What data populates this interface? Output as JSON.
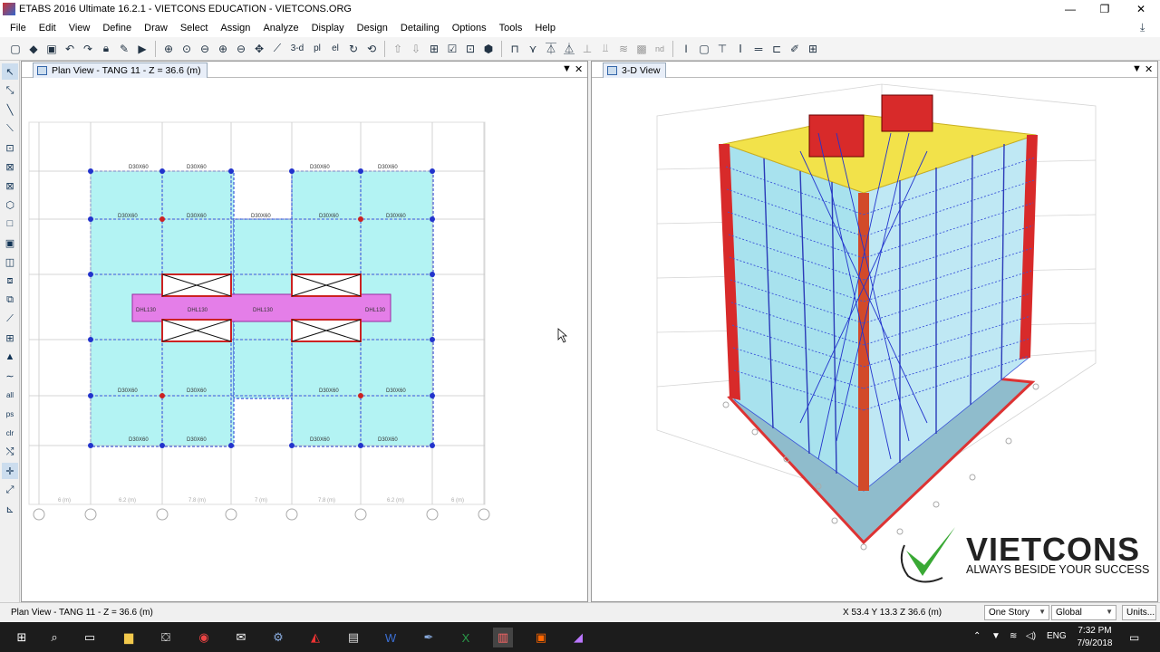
{
  "window": {
    "title": "ETABS 2016 Ultimate 16.2.1 - VIETCONS EDUCATION - VIETCONS.ORG",
    "minimize": "—",
    "maximize": "❐",
    "close": "✕"
  },
  "menu": [
    "File",
    "Edit",
    "View",
    "Define",
    "Draw",
    "Select",
    "Assign",
    "Analyze",
    "Display",
    "Design",
    "Detailing",
    "Options",
    "Tools",
    "Help"
  ],
  "toolbar": {
    "view_3d_label": "3-d",
    "plan_label": "pl",
    "elev_label": "el",
    "nd_label": "nd"
  },
  "left_pane": {
    "tab_title": "Plan View - TANG 11 - Z = 36.6 (m)",
    "dropdown_icon": "▼",
    "close_icon": "✕",
    "grid_labels": [
      "6 (m)",
      "6.2 (m)",
      "7.8 (m)",
      "7 (m)",
      "7.8 (m)",
      "6.2 (m)",
      "6 (m)"
    ],
    "beam_label": "D30X60",
    "slab_label": "DHL130"
  },
  "right_pane": {
    "tab_title": "3-D View",
    "dropdown_icon": "▼",
    "close_icon": "✕"
  },
  "logo": {
    "name": "VIETCONS",
    "tagline": "ALWAYS BESIDE YOUR SUCCESS",
    "accent_color": "#3aa935"
  },
  "status": {
    "text": "Plan View - TANG 11 - Z = 36.6 (m)",
    "coords": "X 53.4  Y 13.3  Z 36.6 (m)",
    "story_select": "One Story",
    "coord_select": "Global",
    "units_button": "Units..."
  },
  "taskbar": {
    "language": "ENG",
    "time": "7:32 PM",
    "date": "7/9/2018"
  },
  "colors": {
    "slab": "#b3f3f3",
    "opening_strip": "#e47ee8",
    "beam": "#3a54d8",
    "wall": "#d82a2a"
  }
}
